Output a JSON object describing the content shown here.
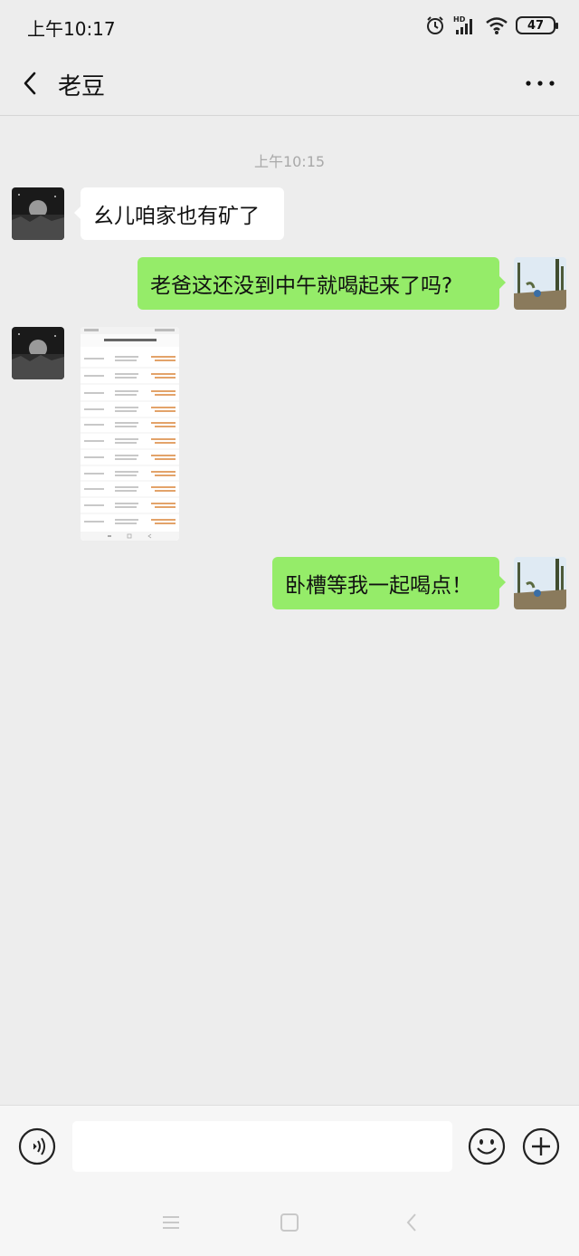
{
  "status_bar": {
    "time": "上午10:17",
    "battery": "47",
    "network": "HD"
  },
  "chat": {
    "title": "老豆"
  },
  "messages": {
    "timestamp": "上午10:15",
    "m1": "幺儿咱家也有矿了",
    "m2": "老爸这还没到中午就喝起来了吗?",
    "m4": "卧槽等我一起喝点！"
  },
  "input": {
    "placeholder": ""
  },
  "icons": {
    "back": "back-arrow-icon",
    "more": "more-dots-icon",
    "voice": "voice-icon",
    "emoji": "emoji-icon",
    "plus": "plus-icon"
  },
  "colors": {
    "background": "#ededed",
    "sent_bubble": "#95ec69",
    "received_bubble": "#ffffff"
  }
}
